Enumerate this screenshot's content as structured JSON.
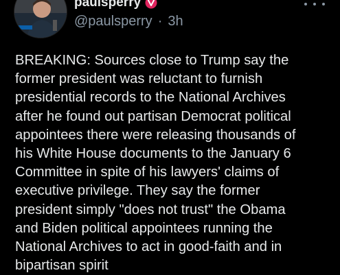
{
  "author": {
    "display_name": "paulsperry",
    "handle": "@paulsperry",
    "separator": "·",
    "time_ago": "3h",
    "verified_icon": "verified-badge-icon",
    "verified_color": "#e0245e"
  },
  "actions": {
    "more_icon": "more-horizontal-icon"
  },
  "post": {
    "text": "BREAKING: Sources close to Trump say the\nformer president was reluctant to furnish\npresidential records to the National Archives\nafter he found out partisan Democrat political\nappointees there were releasing thousands of\nhis White House documents to the January 6\nCommittee in spite of his lawyers' claims of\nexecutive privilege. They say the former\npresident simply \"does not trust\" the Obama\nand Biden political appointees running the\nNational Archives to act in good-faith and in\nbipartisan spirit"
  },
  "colors": {
    "background": "#000000",
    "text": "#e7e9ea",
    "secondary_text": "#8b98a5"
  }
}
